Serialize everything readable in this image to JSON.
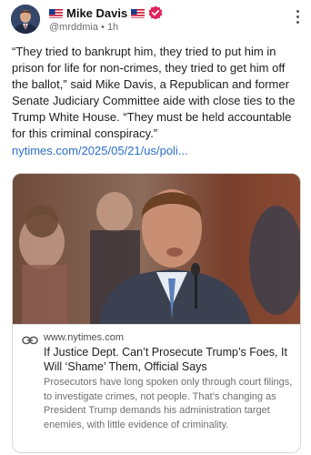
{
  "author": {
    "name": "Mike Davis",
    "flag_left": "🇺🇸",
    "flag_right": "🇺🇸",
    "handle": "@mrddmia",
    "separator": "•",
    "time": "1h"
  },
  "post": {
    "text": "“They tried to bankrupt him, they tried to put him in prison for life for non-crimes, they tried to get him off the ballot,” said Mike Davis, a Republican and former Senate Judiciary Committee aide with close ties to the Trump White House. “They must be held accountable for this criminal conspiracy.”",
    "link": "nytimes.com/2025/05/21/us/poli..."
  },
  "card": {
    "domain": "www.nytimes.com",
    "title": "If Justice Dept. Can’t Prosecute Trump’s Foes, It Will ‘Shame’ Them, Official Says",
    "description": "Prosecutors have long spoken only through court filings, to investigate crimes, not people. That’s changing as President Trump demands his administration target enemies, with little evidence of criminality."
  },
  "colors": {
    "link": "#2b6fc7",
    "verified": "#e0245e",
    "text": "#1d1d1d",
    "muted": "#6e6e6e"
  },
  "icons": [
    "us-flag-icon",
    "verified-badge-icon",
    "more-options-icon",
    "link-icon"
  ]
}
